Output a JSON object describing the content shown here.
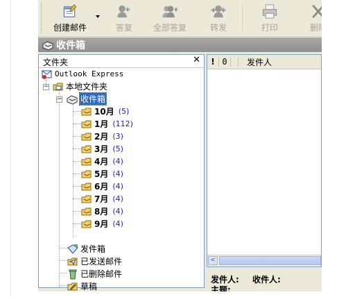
{
  "toolbar": {
    "buttons": [
      {
        "label": "创建邮件",
        "icon": "new-mail-icon",
        "enabled": true
      },
      {
        "label": "答复",
        "icon": "reply-icon",
        "enabled": false
      },
      {
        "label": "全部答复",
        "icon": "reply-all-icon",
        "enabled": false
      },
      {
        "label": "转发",
        "icon": "forward-icon",
        "enabled": false
      },
      {
        "label": "打印",
        "icon": "print-icon",
        "enabled": false
      },
      {
        "label": "删除",
        "icon": "delete-icon",
        "enabled": false
      }
    ]
  },
  "title_bar": {
    "title": "收件箱",
    "icon": "inbox-icon"
  },
  "folder_pane": {
    "header": "文件夹",
    "close_glyph": "✕",
    "root": "Outlook Express",
    "local_folders": "本地文件夹",
    "inbox": "收件箱",
    "subfolders": [
      {
        "name": "10月",
        "count": "(5)"
      },
      {
        "name": "1月",
        "count": "(112)"
      },
      {
        "name": "2月",
        "count": "(3)"
      },
      {
        "name": "3月",
        "count": "(5)"
      },
      {
        "name": "4月",
        "count": "(4)"
      },
      {
        "name": "5月",
        "count": "(4)"
      },
      {
        "name": "6月",
        "count": "(4)"
      },
      {
        "name": "7月",
        "count": "(4)"
      },
      {
        "name": "8月",
        "count": "(4)"
      },
      {
        "name": "9月",
        "count": "(4)"
      }
    ],
    "other_folders": [
      {
        "name": "发件箱",
        "icon": "outbox-icon"
      },
      {
        "name": "已发送邮件",
        "icon": "sent-items-icon"
      },
      {
        "name": "已删除邮件",
        "icon": "deleted-items-icon"
      },
      {
        "name": "草稿",
        "icon": "drafts-icon"
      }
    ]
  },
  "message_list": {
    "col_priority": "!",
    "col_attachment": "0",
    "col_from": "发件人",
    "scroll_left": "<"
  },
  "preview": {
    "from_label": "发件人:",
    "from_label2": "收件人:",
    "subject_label": "主题:"
  },
  "colors": {
    "selection": "#316ac5",
    "count": "#2020c0"
  }
}
